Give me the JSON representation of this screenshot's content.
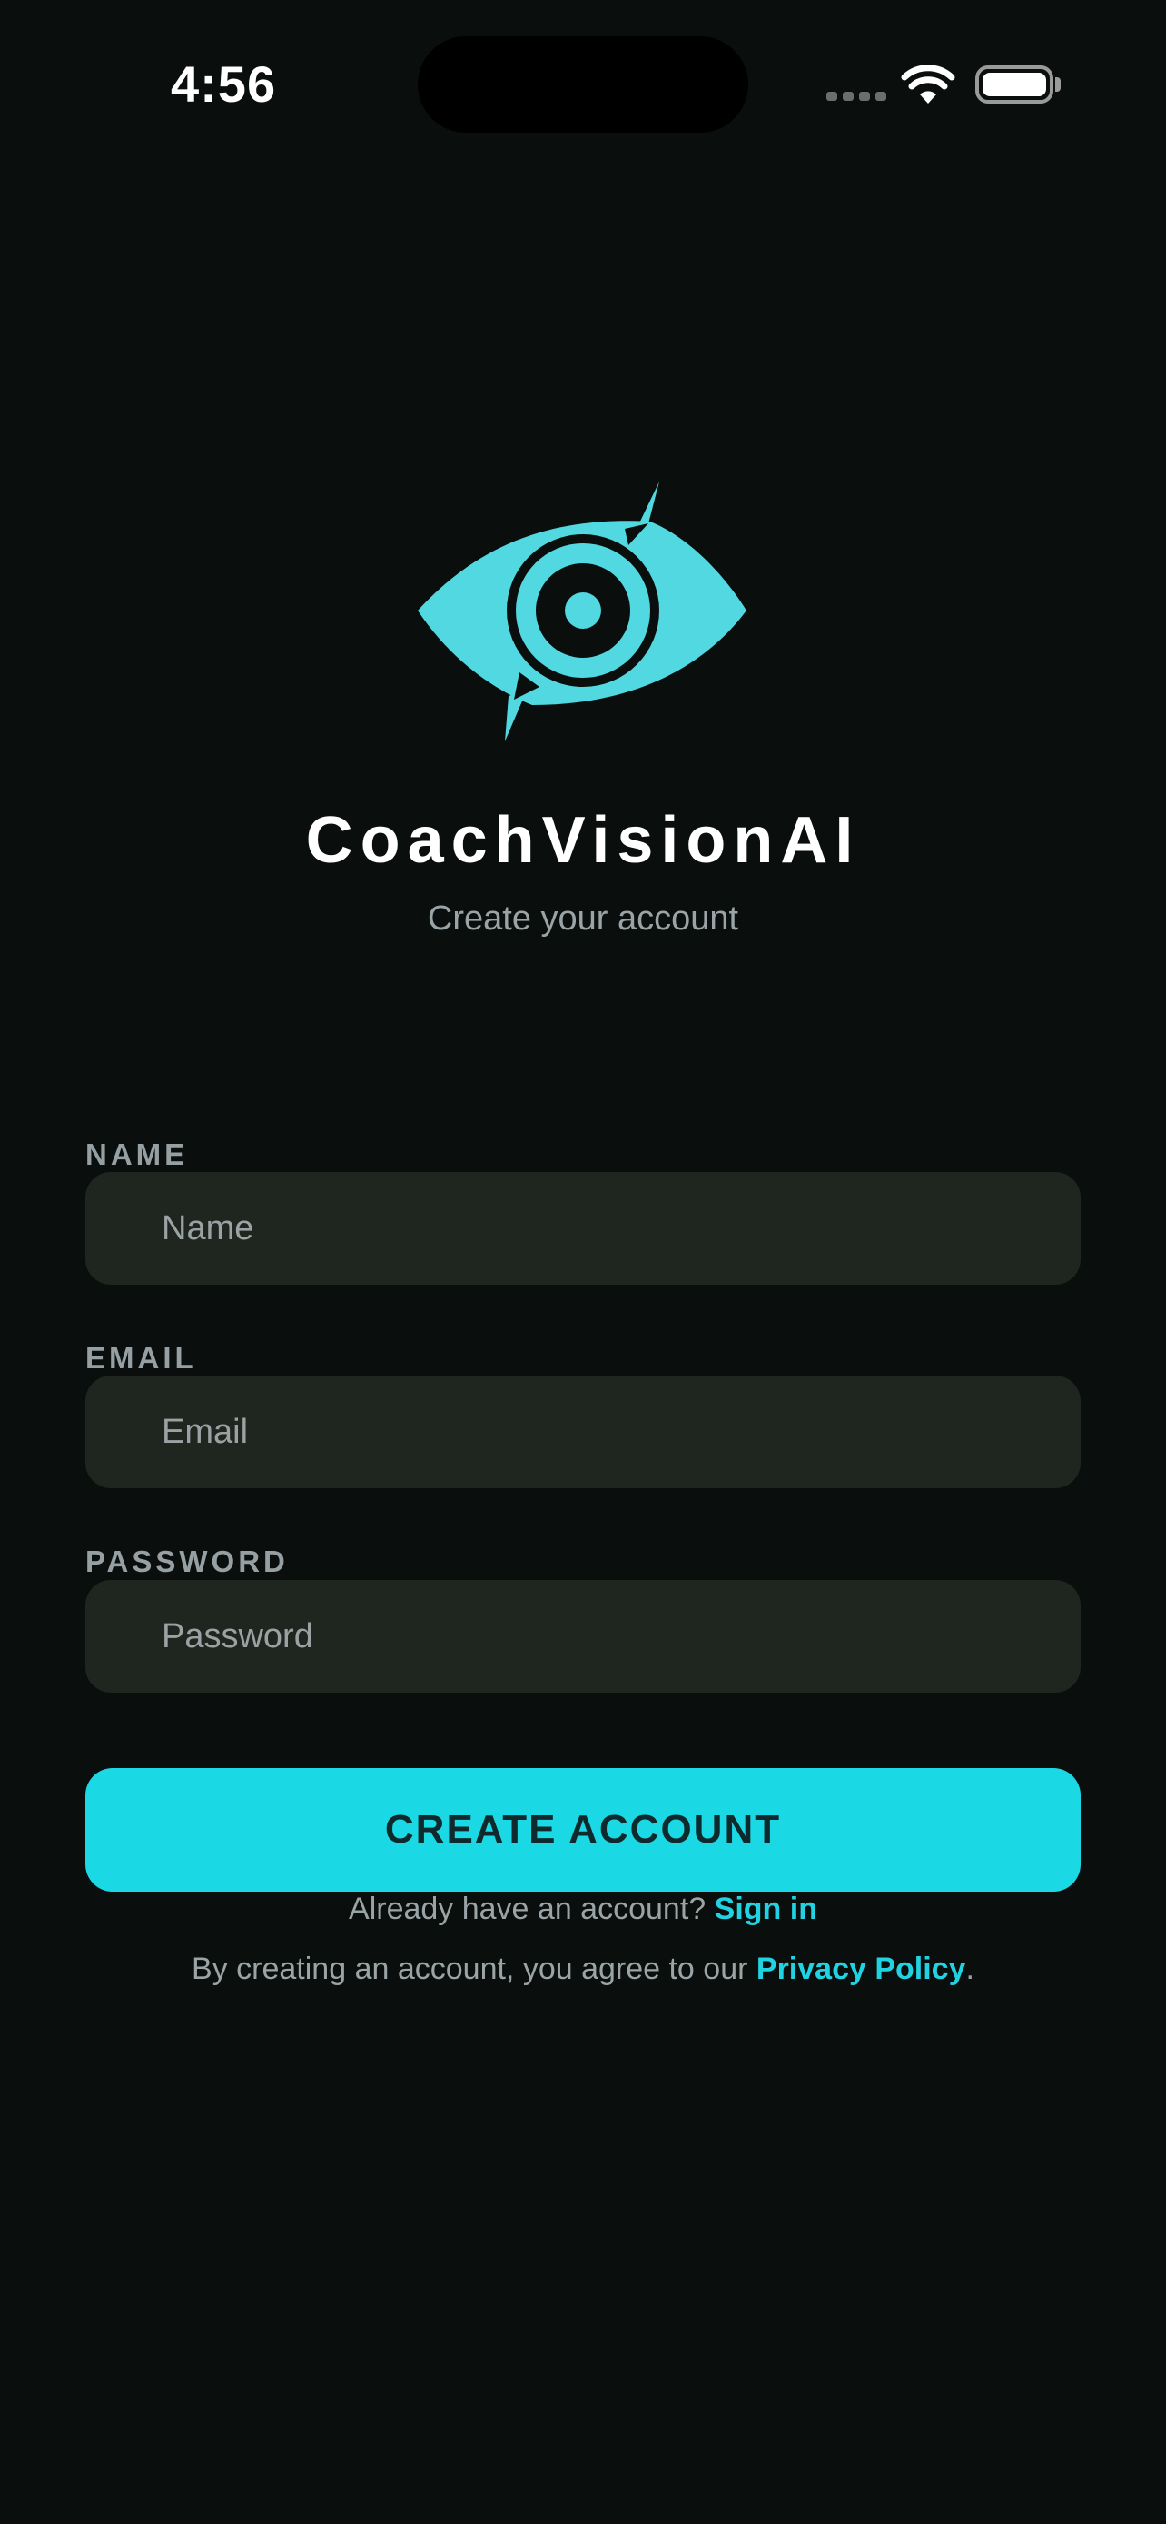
{
  "status_bar": {
    "time": "4:56"
  },
  "brand": {
    "app_name": "CoachVisionAI",
    "subtitle": "Create your account",
    "accent_color": "#1AD9E5",
    "logo_icon": "eye-logo-icon"
  },
  "form": {
    "name": {
      "label": "NAME",
      "placeholder": "Name",
      "value": ""
    },
    "email": {
      "label": "EMAIL",
      "placeholder": "Email",
      "value": ""
    },
    "password": {
      "label": "PASSWORD",
      "placeholder": "Password",
      "value": ""
    },
    "submit_label": "CREATE ACCOUNT"
  },
  "footer": {
    "signin_prompt": "Already have an account?",
    "signin_link": "Sign in",
    "legal_prefix": "By creating an account, you agree to our",
    "legal_link": "Privacy Policy",
    "legal_suffix": "."
  }
}
